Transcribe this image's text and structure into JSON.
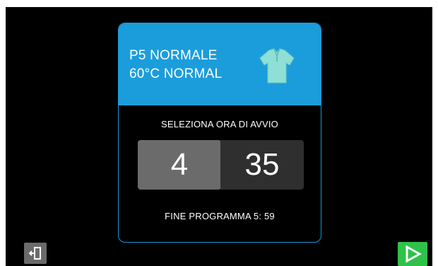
{
  "program": {
    "line1": "P5 NORMALE",
    "line2": "60°C NORMAL",
    "icon": "shirt-icon"
  },
  "start_time": {
    "label": "SELEZIONA ORA DI AVVIO",
    "hours": "4",
    "minutes": "35"
  },
  "end_time": {
    "text": "FINE PROGRAMMA 5: 59"
  },
  "controls": {
    "exit_icon": "exit-door-icon",
    "start_icon": "play-icon"
  },
  "colors": {
    "background": "#000000",
    "header": "#1c9ddb",
    "card_border": "#1598d8",
    "hours_box": "#6b6b6b",
    "minutes_box": "#2f2f2f",
    "start_button": "#2ec24a",
    "shirt": "#8ee0d6"
  }
}
